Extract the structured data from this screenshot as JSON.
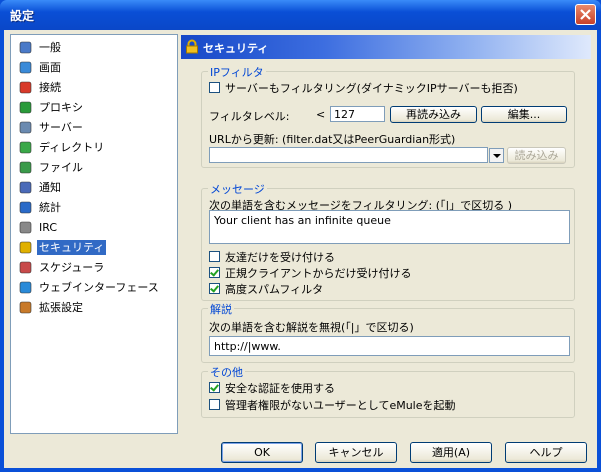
{
  "window": {
    "title": "設定"
  },
  "nav": {
    "items": [
      {
        "label": "一般",
        "icon": "general-icon"
      },
      {
        "label": "画面",
        "icon": "display-icon"
      },
      {
        "label": "接続",
        "icon": "connection-icon"
      },
      {
        "label": "プロキシ",
        "icon": "proxy-icon"
      },
      {
        "label": "サーバー",
        "icon": "server-icon"
      },
      {
        "label": "ディレクトリ",
        "icon": "directory-icon"
      },
      {
        "label": "ファイル",
        "icon": "file-icon"
      },
      {
        "label": "通知",
        "icon": "notify-icon"
      },
      {
        "label": "統計",
        "icon": "stats-icon"
      },
      {
        "label": "IRC",
        "icon": "irc-icon"
      },
      {
        "label": "セキュリティ",
        "icon": "lock-icon",
        "selected": true
      },
      {
        "label": "スケジューラ",
        "icon": "scheduler-icon"
      },
      {
        "label": "ウェブインターフェース",
        "icon": "web-icon"
      },
      {
        "label": "拡張設定",
        "icon": "advanced-icon"
      }
    ]
  },
  "header": {
    "title": "セキュリティ"
  },
  "ipfilter": {
    "legend": "IPフィルタ",
    "filter_servers_label": "サーバーもフィルタリング(ダイナミックIPサーバーも拒否)",
    "filter_servers_checked": false,
    "level_label": "フィルタレベル:",
    "level_lt": "<",
    "level_value": "127",
    "reload_button": "再読み込み",
    "edit_button": "編集...",
    "url_label": "URLから更新: (filter.dat又はPeerGuardian形式)",
    "url_value": "",
    "load_button": "読み込み"
  },
  "messages": {
    "legend": "メッセージ",
    "filter_label": "次の単語を含むメッセージをフィルタリング: (「|」で区切る )",
    "filter_value": "Your client has an infinite queue",
    "friends_only_label": "友達だけを受け付ける",
    "friends_only_checked": false,
    "official_only_label": "正規クライアントからだけ受け付ける",
    "official_only_checked": true,
    "spam_filter_label": "高度スパムフィルタ",
    "spam_filter_checked": true
  },
  "comments": {
    "legend": "解説",
    "ignore_label": "次の単語を含む解説を無視(「|」で区切る)",
    "ignore_value": "http://|www."
  },
  "other": {
    "legend": "その他",
    "secure_ident_label": "安全な認証を使用する",
    "secure_ident_checked": true,
    "no_admin_label": "管理者権限がないユーザーとしてeMuleを起動",
    "no_admin_checked": false
  },
  "buttons": {
    "ok": "OK",
    "cancel": "キャンセル",
    "apply": "適用(A)",
    "help": "ヘルプ"
  }
}
